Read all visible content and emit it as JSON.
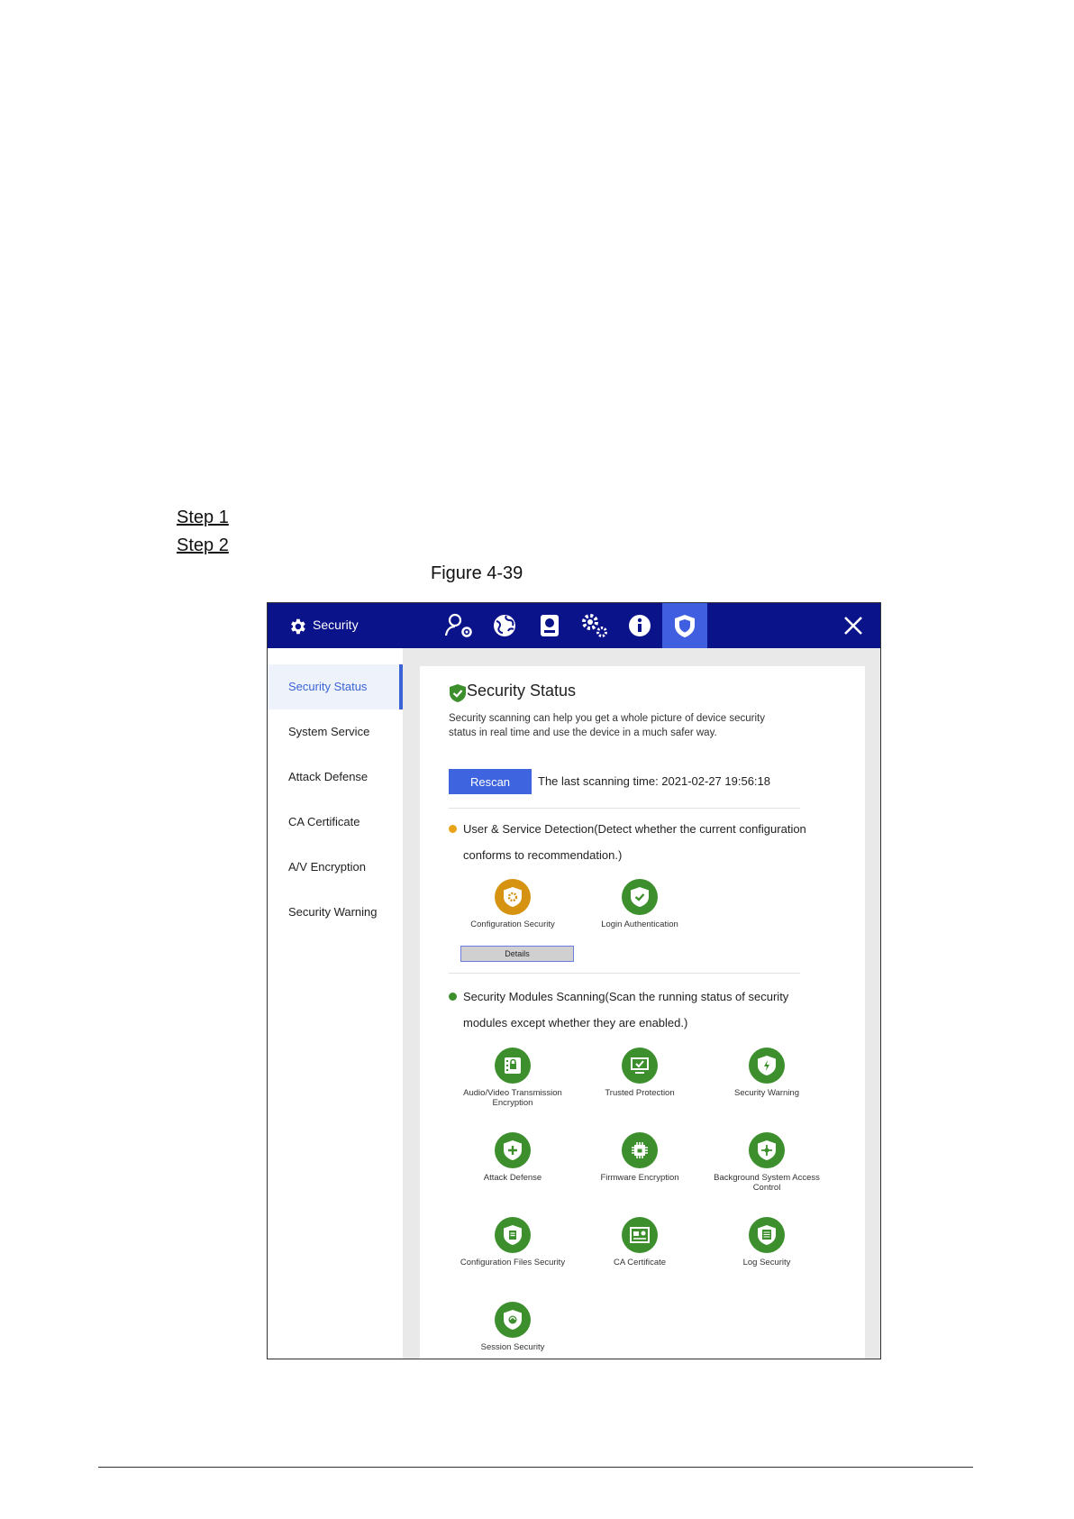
{
  "steps": {
    "step1": "Step 1",
    "step2": "Step 2"
  },
  "figure_caption": "Figure 4-39",
  "window": {
    "title": "Security",
    "title_icon": "gear-icon"
  },
  "toolbar": [
    {
      "name": "user-settings-icon"
    },
    {
      "name": "network-icon"
    },
    {
      "name": "storage-icon"
    },
    {
      "name": "system-settings-icon"
    },
    {
      "name": "info-icon"
    },
    {
      "name": "security-shield-icon",
      "active": true
    }
  ],
  "sidebar": {
    "items": [
      {
        "label": "Security Status",
        "active": true
      },
      {
        "label": "System Service"
      },
      {
        "label": "Attack Defense"
      },
      {
        "label": "CA Certificate"
      },
      {
        "label": "A/V Encryption"
      },
      {
        "label": "Security Warning"
      }
    ]
  },
  "main": {
    "title": "Security Status",
    "description": "Security scanning can help you get a whole picture of device security status in real time and use the device in a much safer way.",
    "rescan_label": "Rescan",
    "last_scan": "The last scanning time: 2021-02-27 19:56:18",
    "user_service": {
      "heading": "User & Service Detection(Detect whether the current configuration conforms to recommendation.)",
      "status_color": "#e8a317",
      "items": [
        {
          "label": "Configuration Security",
          "status": "warning"
        },
        {
          "label": "Login Authentication",
          "status": "ok"
        }
      ],
      "details_label": "Details"
    },
    "modules": {
      "heading": "Security Modules Scanning(Scan the running status of security modules except whether they are enabled.)",
      "status_color": "#3d8f2e",
      "items": [
        {
          "label": "Audio/Video Transmission Encryption"
        },
        {
          "label": "Trusted Protection"
        },
        {
          "label": "Security Warning"
        },
        {
          "label": "Attack Defense"
        },
        {
          "label": "Firmware Encryption"
        },
        {
          "label": "Background System Access Control"
        },
        {
          "label": "Configuration Files Security"
        },
        {
          "label": "CA Certificate"
        },
        {
          "label": "Log Security"
        },
        {
          "label": "Session Security"
        }
      ]
    }
  },
  "colors": {
    "titlebar": "#0b138a",
    "accent": "#3e64e0",
    "ok": "#3d8f2e",
    "warning": "#d69312"
  }
}
